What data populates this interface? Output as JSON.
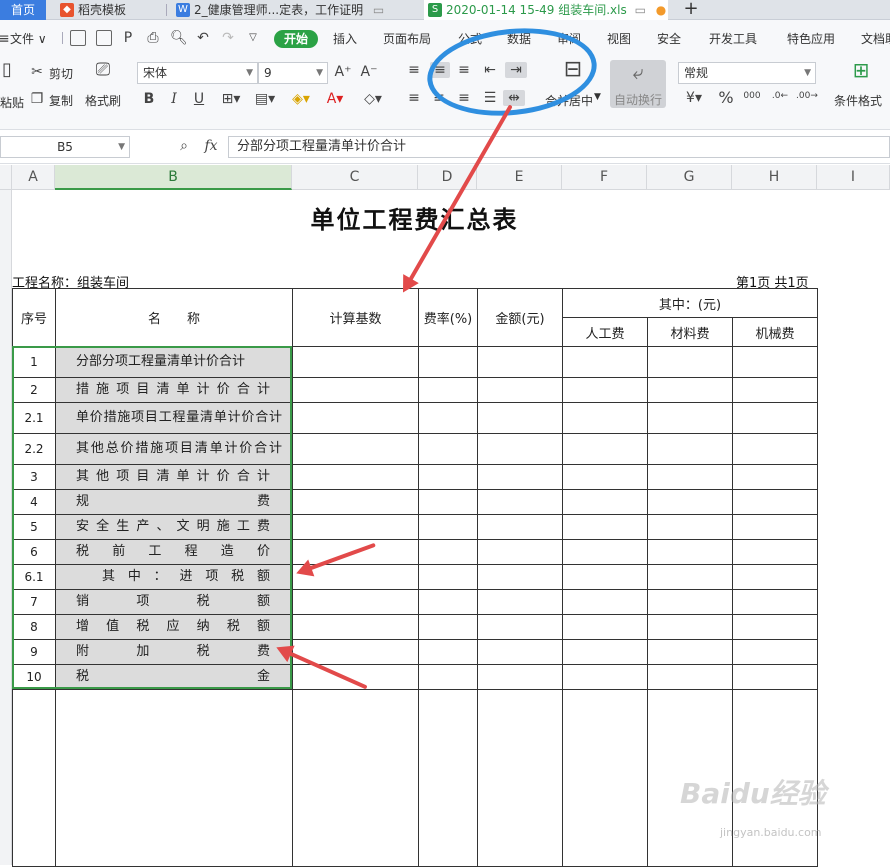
{
  "tabs": [
    {
      "label": "首页"
    },
    {
      "label": "稻壳模板"
    },
    {
      "label": "2_健康管理师...定表，工作证明"
    },
    {
      "label": "2020-01-14 15-49 组装车间.xls"
    }
  ],
  "menu": [
    "文件",
    "开始",
    "插入",
    "页面布局",
    "公式",
    "数据",
    "审阅",
    "视图",
    "安全",
    "开发工具",
    "特色应用",
    "文档助手"
  ],
  "ribbon": {
    "paste": "粘贴",
    "cut": "剪切",
    "copy": "复制",
    "format_painter": "格式刷",
    "font_name": "宋体",
    "font_size": "9",
    "merge_center": "合并居中",
    "wrap_text": "自动换行",
    "number_format": "常规",
    "cond_format": "条件格式"
  },
  "formula_bar": {
    "cell_ref": "B5",
    "fx": "fx",
    "content": "分部分项工程量清单计价合计"
  },
  "columns": [
    "A",
    "B",
    "C",
    "D",
    "E",
    "F",
    "G",
    "H",
    "I"
  ],
  "sheet": {
    "title": "单位工程费汇总表",
    "project": "工程名称：组装车间",
    "page": "第1页 共1页",
    "headers": {
      "seq": "序号",
      "name": "名　　称",
      "base": "计算基数",
      "rate": "费率(%)",
      "amount": "金额(元)",
      "among": "其中：(元)",
      "labor": "人工费",
      "material": "材料费",
      "machine": "机械费"
    },
    "rows": [
      {
        "seq": "1",
        "name": "分部分项工程量清单计价合计"
      },
      {
        "seq": "2",
        "name": "措施项目清单计价合计"
      },
      {
        "seq": "2.1",
        "name": "单价措施项目工程量清单计价合计"
      },
      {
        "seq": "2.2",
        "name": "其他总价措施项目清单计价合计"
      },
      {
        "seq": "3",
        "name": "其他项目清单计价合计"
      },
      {
        "seq": "4",
        "name": "规费"
      },
      {
        "seq": "5",
        "name": "安全生产、文明施工费"
      },
      {
        "seq": "6",
        "name": "税前工程造价"
      },
      {
        "seq": "6.1",
        "name": "其中：进项税额"
      },
      {
        "seq": "7",
        "name": "销项税额"
      },
      {
        "seq": "8",
        "name": "增值税应纳税额"
      },
      {
        "seq": "9",
        "name": "附加税费"
      },
      {
        "seq": "10",
        "name": "税金"
      }
    ]
  },
  "watermark": {
    "brand": "Baidu经验",
    "url": "jingyan.baidu.com"
  },
  "colors": {
    "accent_green": "#2ba245",
    "annotation_blue": "#2f8fe0",
    "arrow_red": "#e24a4a",
    "selection": "#3a9a48"
  }
}
